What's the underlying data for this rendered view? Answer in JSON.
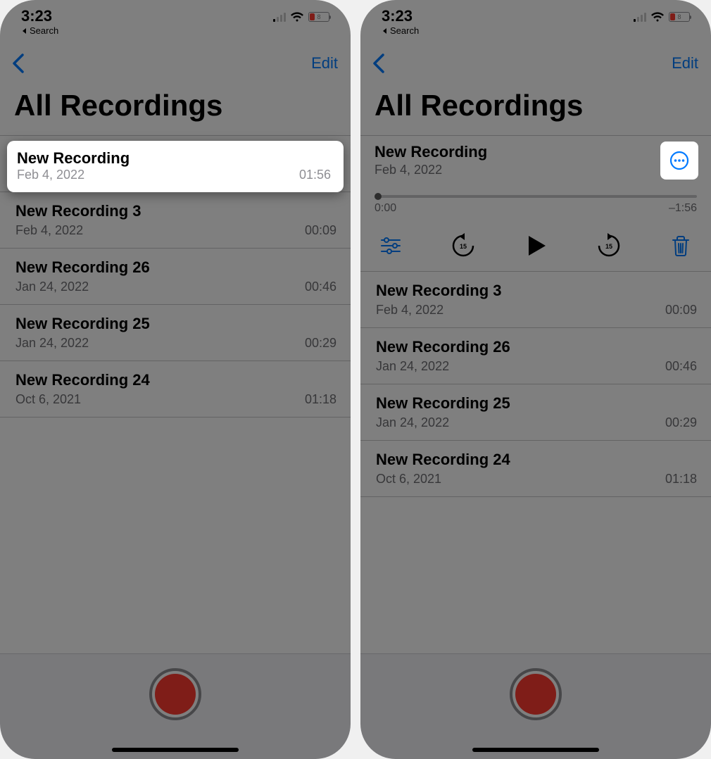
{
  "status": {
    "time": "3:23",
    "breadcrumb_label": "Search",
    "battery_percent": "8"
  },
  "nav": {
    "edit_label": "Edit"
  },
  "page": {
    "title": "All Recordings"
  },
  "recordings": [
    {
      "title": "New Recording",
      "date": "Feb 4, 2022",
      "duration": "01:56"
    },
    {
      "title": "New Recording 3",
      "date": "Feb 4, 2022",
      "duration": "00:09"
    },
    {
      "title": "New Recording 26",
      "date": "Jan 24, 2022",
      "duration": "00:46"
    },
    {
      "title": "New Recording 25",
      "date": "Jan 24, 2022",
      "duration": "00:29"
    },
    {
      "title": "New Recording 24",
      "date": "Oct 6, 2021",
      "duration": "01:18"
    }
  ],
  "player": {
    "elapsed": "0:00",
    "remaining": "–1:56",
    "skip_secs": "15"
  }
}
